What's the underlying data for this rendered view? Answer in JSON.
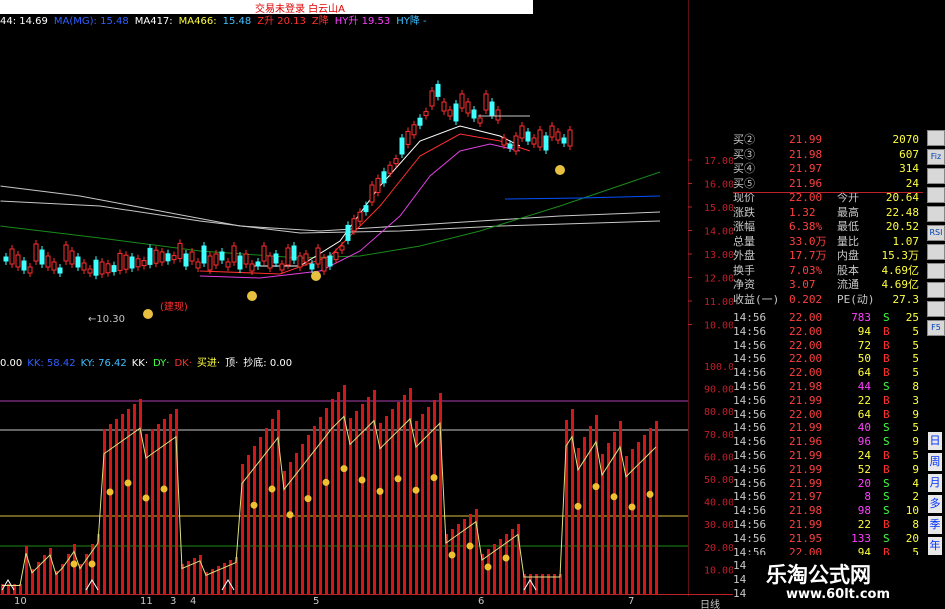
{
  "title_strip": {
    "text": "交易未登录 白云山A"
  },
  "ma_header": {
    "items": [
      {
        "text": "44: 14.69",
        "color": "#ffffff"
      },
      {
        "text": "MA(MG): 15.48",
        "color": "#3060ff"
      },
      {
        "text": "MA417:",
        "color": "#ffffff"
      },
      {
        "text": "MA466:",
        "color": "#ffff40"
      },
      {
        "text": "15.48",
        "color": "#40c0ff"
      },
      {
        "text": "Z升 20.13",
        "color": "#ff3030"
      },
      {
        "text": "Z降",
        "color": "#ff3030"
      },
      {
        "text": "HY升 19.53",
        "color": "#ff40ff"
      },
      {
        "text": "HY降 -",
        "color": "#40c0ff"
      }
    ]
  },
  "price_axis": [
    "17.00",
    "16.00",
    "15.00",
    "14.00",
    "13.00",
    "12.00",
    "11.00",
    "10.00"
  ],
  "annotations": {
    "low_price": "←10.30",
    "signal": "(建现)"
  },
  "indicator_header": {
    "items": [
      {
        "text": "0.00",
        "color": "#ffffff"
      },
      {
        "text": "KK: 58.42",
        "color": "#3060ff"
      },
      {
        "text": "KY: 76.42",
        "color": "#40c0ff"
      },
      {
        "text": "KK·",
        "color": "#ffffff"
      },
      {
        "text": "DY·",
        "color": "#40ff40"
      },
      {
        "text": "DK·",
        "color": "#ff3030"
      },
      {
        "text": "买进·",
        "color": "#ffff40"
      },
      {
        "text": "顶·",
        "color": "#ffffff"
      },
      {
        "text": "抄底: 0.00",
        "color": "#ffffff"
      }
    ]
  },
  "indicator_axis": [
    "100.0",
    "90.00",
    "80.00",
    "70.00",
    "60.00",
    "50.00",
    "40.00",
    "30.00",
    "20.00",
    "10.00"
  ],
  "x_axis_labels": [
    "10",
    "11",
    "3",
    "4",
    "5",
    "6",
    "7"
  ],
  "period_label": "日线",
  "quote_panel": {
    "rows": [
      {
        "l": "买②",
        "v": "21.99",
        "v2": "2070"
      },
      {
        "l": "买③",
        "v": "21.98",
        "v2": "607"
      },
      {
        "l": "买④",
        "v": "21.97",
        "v2": "314"
      },
      {
        "l": "买⑤",
        "v": "21.96",
        "v2": "24"
      },
      {
        "l": "现价",
        "v": "22.00",
        "l2": "今开",
        "v2": "20.64"
      },
      {
        "l": "涨跌",
        "v": "1.32",
        "l2": "最高",
        "v2": "22.48"
      },
      {
        "l": "涨幅",
        "v": "6.38%",
        "l2": "最低",
        "v2": "20.52"
      },
      {
        "l": "总量",
        "v": "33.0万",
        "l2": "量比",
        "v2": "1.07"
      },
      {
        "l": "外盘",
        "v": "17.7万",
        "l2": "内盘",
        "v2": "15.3万"
      },
      {
        "l": "换手",
        "v": "7.03%",
        "l2": "股本",
        "v2": "4.69亿"
      },
      {
        "l": "净资",
        "v": "3.07",
        "l2": "流通",
        "v2": "4.69亿"
      },
      {
        "l": "收益(一)",
        "v": "0.202",
        "l2": "PE(动)",
        "v2": "27.3"
      }
    ]
  },
  "ticks": [
    {
      "t": "14:56",
      "p": "22.00",
      "q": "783",
      "s": "S",
      "n": "25"
    },
    {
      "t": "14:56",
      "p": "22.00",
      "q": "94",
      "s": "B",
      "n": "5"
    },
    {
      "t": "14:56",
      "p": "22.00",
      "q": "72",
      "s": "B",
      "n": "5"
    },
    {
      "t": "14:56",
      "p": "22.00",
      "q": "50",
      "s": "B",
      "n": "5"
    },
    {
      "t": "14:56",
      "p": "22.00",
      "q": "64",
      "s": "B",
      "n": "5"
    },
    {
      "t": "14:56",
      "p": "21.98",
      "q": "44",
      "s": "S",
      "n": "8"
    },
    {
      "t": "14:56",
      "p": "21.99",
      "q": "22",
      "s": "B",
      "n": "3"
    },
    {
      "t": "14:56",
      "p": "22.00",
      "q": "64",
      "s": "B",
      "n": "9"
    },
    {
      "t": "14:56",
      "p": "21.99",
      "q": "40",
      "s": "S",
      "n": "5"
    },
    {
      "t": "14:56",
      "p": "21.96",
      "q": "96",
      "s": "S",
      "n": "9"
    },
    {
      "t": "14:56",
      "p": "21.99",
      "q": "24",
      "s": "B",
      "n": "5"
    },
    {
      "t": "14:56",
      "p": "21.99",
      "q": "52",
      "s": "B",
      "n": "9"
    },
    {
      "t": "14:56",
      "p": "21.99",
      "q": "20",
      "s": "S",
      "n": "4"
    },
    {
      "t": "14:56",
      "p": "21.97",
      "q": "8",
      "s": "S",
      "n": "2"
    },
    {
      "t": "14:56",
      "p": "21.98",
      "q": "98",
      "s": "S",
      "n": "10"
    },
    {
      "t": "14:56",
      "p": "21.99",
      "q": "22",
      "s": "B",
      "n": "8"
    },
    {
      "t": "14:56",
      "p": "21.95",
      "q": "133",
      "s": "S",
      "n": "20"
    },
    {
      "t": "14:56",
      "p": "22.00",
      "q": "94",
      "s": "B",
      "n": "5"
    },
    {
      "t": "14:",
      "p": "",
      "q": "",
      "s": "",
      "n": ""
    },
    {
      "t": "14:",
      "p": "",
      "q": "",
      "s": "",
      "n": ""
    },
    {
      "t": "14:",
      "p": "",
      "q": "",
      "s": "",
      "n": ""
    }
  ],
  "toolbar": [
    "",
    "Fiz",
    "",
    "",
    "",
    "RSI",
    "",
    "",
    "",
    "",
    "F5"
  ],
  "periods": [
    "日",
    "周",
    "月",
    "多",
    "季",
    "年"
  ],
  "watermark": {
    "line1": "乐淘公式网",
    "line2": "www.60lt.com"
  },
  "colors": {
    "up": "#ff3030",
    "down": "#40ffff",
    "bar": "#d01818",
    "kline": "#ffffff"
  }
}
